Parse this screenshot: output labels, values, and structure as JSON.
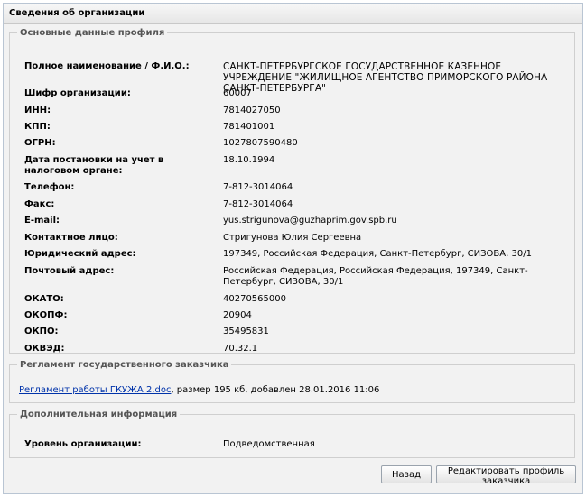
{
  "window": {
    "title": "Сведения об организации"
  },
  "main": {
    "legend": "Основные данные профиля",
    "rows": [
      {
        "label": "Полное наименование / Ф.И.О.:",
        "value": "САНКТ-ПЕТЕРБУРГСКОЕ ГОСУДАРСТВЕННОЕ КАЗЕННОЕ УЧРЕЖДЕНИЕ \"ЖИЛИЩНОЕ АГЕНТСТВО ПРИМОРСКОГО РАЙОНА САНКТ-ПЕТЕРБУРГА\""
      },
      {
        "label": "Шифр организации:",
        "value": "60007"
      },
      {
        "label": "ИНН:",
        "value": "7814027050"
      },
      {
        "label": "КПП:",
        "value": "781401001"
      },
      {
        "label": "ОГРН:",
        "value": "1027807590480"
      },
      {
        "label": "Дата постановки на учет в налоговом органе:",
        "value": "18.10.1994"
      },
      {
        "label": "Телефон:",
        "value": "7-812-3014064"
      },
      {
        "label": "Факс:",
        "value": "7-812-3014064"
      },
      {
        "label": "E-mail:",
        "value": "yus.strigunova@guzhaprim.gov.spb.ru"
      },
      {
        "label": "Контактное лицо:",
        "value": "Стригунова Юлия Сергеевна"
      },
      {
        "label": "Юридический адрес:",
        "value": "197349, Российская Федерация, Санкт-Петербург, СИЗОВА, 30/1"
      },
      {
        "label": "Почтовый адрес:",
        "value": "Российская Федерация, Российская Федерация, 197349, Санкт-Петербург, СИЗОВА, 30/1"
      },
      {
        "label": "ОКАТО:",
        "value": "40270565000"
      },
      {
        "label": "ОКОПФ:",
        "value": "20904"
      },
      {
        "label": "ОКПО:",
        "value": "35495831"
      },
      {
        "label": "ОКВЭД:",
        "value": "70.32.1"
      }
    ]
  },
  "reglament": {
    "legend": "Регламент государственного заказчика",
    "link": "Регламент работы ГКУЖА 2.doc",
    "details": ", размер 195 кб, добавлен 28.01.2016 11:06"
  },
  "extra": {
    "legend": "Дополнительная информация",
    "label": "Уровень организации:",
    "value": "Подведомственная"
  },
  "buttons": {
    "back": "Назад",
    "edit": "Редактировать профиль заказчика"
  }
}
